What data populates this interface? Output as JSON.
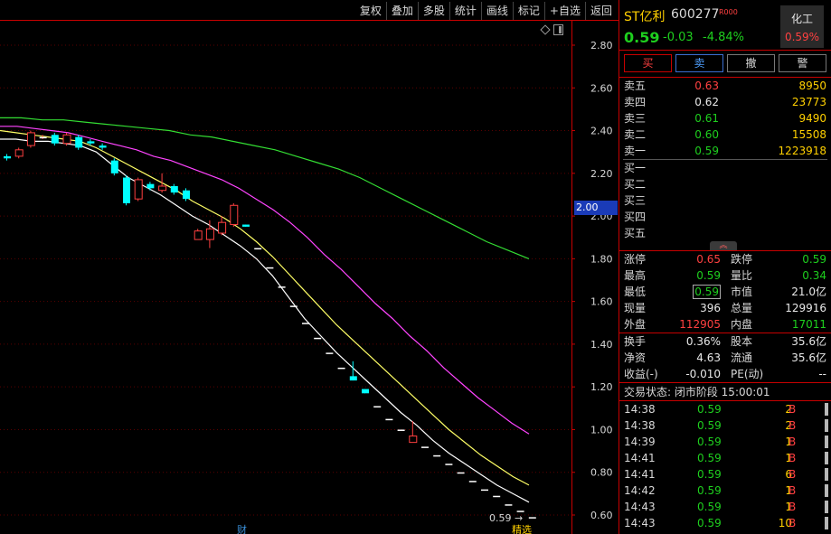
{
  "toolbar": [
    "复权",
    "叠加",
    "多股",
    "统计",
    "画线",
    "标记",
    "+自选",
    "返回"
  ],
  "chart": {
    "y_labels": [
      "2.80",
      "2.60",
      "2.40",
      "2.20",
      "2.00",
      "1.80",
      "1.60",
      "1.40",
      "1.20",
      "1.00",
      "0.80",
      "0.60"
    ],
    "current_price_tag": "2.00",
    "last_price_label": "0.59",
    "marker_cai": "财",
    "marker_jingxuan": "精选",
    "colors": {
      "up": "#ff4040",
      "down": "#00ffff",
      "ma5": "#ffffff",
      "ma10": "#ffff66",
      "ma20": "#ff44ff",
      "ma60": "#33dd33",
      "axis": "#c80000"
    }
  },
  "chart_data": {
    "type": "candlestick",
    "ylim": [
      0.58,
      2.86
    ],
    "candles": [
      {
        "o": 2.28,
        "c": 2.27,
        "h": 2.29,
        "l": 2.26
      },
      {
        "o": 2.28,
        "c": 2.31,
        "h": 2.32,
        "l": 2.27
      },
      {
        "o": 2.33,
        "c": 2.39,
        "h": 2.4,
        "l": 2.32
      },
      {
        "o": 2.37,
        "c": 2.37,
        "h": 2.38,
        "l": 2.36
      },
      {
        "o": 2.38,
        "c": 2.34,
        "h": 2.39,
        "l": 2.33
      },
      {
        "o": 2.34,
        "c": 2.38,
        "h": 2.39,
        "l": 2.33
      },
      {
        "o": 2.37,
        "c": 2.32,
        "h": 2.38,
        "l": 2.31
      },
      {
        "o": 2.35,
        "c": 2.34,
        "h": 2.36,
        "l": 2.33
      },
      {
        "o": 2.33,
        "c": 2.32,
        "h": 2.34,
        "l": 2.31
      },
      {
        "o": 2.26,
        "c": 2.2,
        "h": 2.27,
        "l": 2.19
      },
      {
        "o": 2.18,
        "c": 2.06,
        "h": 2.19,
        "l": 2.05
      },
      {
        "o": 2.08,
        "c": 2.17,
        "h": 2.18,
        "l": 2.07
      },
      {
        "o": 2.15,
        "c": 2.13,
        "h": 2.16,
        "l": 2.12
      },
      {
        "o": 2.12,
        "c": 2.14,
        "h": 2.2,
        "l": 2.11
      },
      {
        "o": 2.14,
        "c": 2.11,
        "h": 2.15,
        "l": 2.1
      },
      {
        "o": 2.12,
        "c": 2.08,
        "h": 2.13,
        "l": 2.07
      },
      {
        "o": 1.89,
        "c": 1.93,
        "h": 1.94,
        "l": 1.89
      },
      {
        "o": 1.89,
        "c": 1.94,
        "h": 1.98,
        "l": 1.85
      },
      {
        "o": 1.92,
        "c": 1.97,
        "h": 2.0,
        "l": 1.91
      },
      {
        "o": 1.96,
        "c": 2.05,
        "h": 2.06,
        "l": 1.95
      },
      {
        "o": 1.96,
        "c": 1.95,
        "h": 1.96,
        "l": 1.95
      },
      {
        "o": 1.85,
        "c": 1.85,
        "h": 1.85,
        "l": 1.85
      },
      {
        "o": 1.76,
        "c": 1.76,
        "h": 1.76,
        "l": 1.76
      },
      {
        "o": 1.67,
        "c": 1.67,
        "h": 1.67,
        "l": 1.67
      },
      {
        "o": 1.58,
        "c": 1.58,
        "h": 1.58,
        "l": 1.58
      },
      {
        "o": 1.5,
        "c": 1.5,
        "h": 1.5,
        "l": 1.5
      },
      {
        "o": 1.43,
        "c": 1.43,
        "h": 1.43,
        "l": 1.43
      },
      {
        "o": 1.36,
        "c": 1.36,
        "h": 1.36,
        "l": 1.36
      },
      {
        "o": 1.29,
        "c": 1.29,
        "h": 1.29,
        "l": 1.29
      },
      {
        "o": 1.25,
        "c": 1.23,
        "h": 1.32,
        "l": 1.23
      },
      {
        "o": 1.19,
        "c": 1.17,
        "h": 1.19,
        "l": 1.17
      },
      {
        "o": 1.11,
        "c": 1.11,
        "h": 1.11,
        "l": 1.11
      },
      {
        "o": 1.05,
        "c": 1.05,
        "h": 1.05,
        "l": 1.05
      },
      {
        "o": 1.0,
        "c": 1.0,
        "h": 1.0,
        "l": 1.0
      },
      {
        "o": 0.94,
        "c": 0.97,
        "h": 1.04,
        "l": 0.94
      },
      {
        "o": 0.92,
        "c": 0.92,
        "h": 0.92,
        "l": 0.92
      },
      {
        "o": 0.88,
        "c": 0.88,
        "h": 0.88,
        "l": 0.88
      },
      {
        "o": 0.84,
        "c": 0.84,
        "h": 0.84,
        "l": 0.84
      },
      {
        "o": 0.8,
        "c": 0.8,
        "h": 0.8,
        "l": 0.8
      },
      {
        "o": 0.76,
        "c": 0.76,
        "h": 0.76,
        "l": 0.76
      },
      {
        "o": 0.72,
        "c": 0.72,
        "h": 0.72,
        "l": 0.72
      },
      {
        "o": 0.69,
        "c": 0.69,
        "h": 0.69,
        "l": 0.69
      },
      {
        "o": 0.65,
        "c": 0.65,
        "h": 0.65,
        "l": 0.65
      },
      {
        "o": 0.62,
        "c": 0.62,
        "h": 0.62,
        "l": 0.62
      },
      {
        "o": 0.59,
        "c": 0.59,
        "h": 0.59,
        "l": 0.59
      }
    ],
    "ma_lines": [
      {
        "name": "ma5",
        "values": [
          2.36,
          2.36,
          2.35,
          2.35,
          2.34,
          2.33,
          2.3,
          2.24,
          2.18,
          2.14,
          2.1,
          2.05,
          2.0,
          1.96,
          1.91,
          1.86,
          1.8,
          1.72,
          1.62,
          1.52,
          1.44,
          1.36,
          1.29,
          1.22,
          1.15,
          1.08,
          1.02,
          0.95,
          0.89,
          0.84,
          0.79,
          0.74,
          0.7,
          0.66
        ]
      },
      {
        "name": "ma10",
        "values": [
          2.4,
          2.39,
          2.38,
          2.37,
          2.36,
          2.35,
          2.32,
          2.28,
          2.24,
          2.2,
          2.16,
          2.12,
          2.07,
          2.03,
          1.99,
          1.94,
          1.88,
          1.81,
          1.73,
          1.65,
          1.57,
          1.49,
          1.42,
          1.35,
          1.28,
          1.21,
          1.14,
          1.07,
          1.0,
          0.94,
          0.88,
          0.83,
          0.78,
          0.74
        ]
      },
      {
        "name": "ma20",
        "values": [
          2.42,
          2.42,
          2.41,
          2.4,
          2.39,
          2.37,
          2.35,
          2.33,
          2.31,
          2.28,
          2.26,
          2.23,
          2.2,
          2.17,
          2.13,
          2.08,
          2.03,
          1.97,
          1.9,
          1.82,
          1.75,
          1.67,
          1.59,
          1.52,
          1.44,
          1.37,
          1.29,
          1.22,
          1.15,
          1.09,
          1.03,
          0.98
        ]
      },
      {
        "name": "ma60",
        "values": [
          2.46,
          2.46,
          2.45,
          2.45,
          2.44,
          2.43,
          2.42,
          2.41,
          2.4,
          2.38,
          2.37,
          2.35,
          2.33,
          2.31,
          2.28,
          2.25,
          2.22,
          2.18,
          2.13,
          2.08,
          2.03,
          1.98,
          1.93,
          1.88,
          1.84,
          1.8
        ]
      }
    ]
  },
  "stock": {
    "name": "ST亿利",
    "code": "600277",
    "badge": "R000",
    "price": "0.59",
    "change": "-0.03",
    "change_pct": "-4.84%",
    "sector": "化工",
    "sector_pct": "0.59%"
  },
  "actions": {
    "buy": "买",
    "sell": "卖",
    "cancel": "撤",
    "alert": "警"
  },
  "order_book": {
    "asks": [
      {
        "label": "卖五",
        "price": "0.63",
        "vol": "8950",
        "color": "red"
      },
      {
        "label": "卖四",
        "price": "0.62",
        "vol": "23773",
        "color": "white"
      },
      {
        "label": "卖三",
        "price": "0.61",
        "vol": "9490",
        "color": "green"
      },
      {
        "label": "卖二",
        "price": "0.60",
        "vol": "15508",
        "color": "green"
      },
      {
        "label": "卖一",
        "price": "0.59",
        "vol": "1223918",
        "color": "green"
      }
    ],
    "bids": [
      {
        "label": "买一",
        "price": "",
        "vol": ""
      },
      {
        "label": "买二",
        "price": "",
        "vol": ""
      },
      {
        "label": "买三",
        "price": "",
        "vol": ""
      },
      {
        "label": "买四",
        "price": "",
        "vol": ""
      },
      {
        "label": "买五",
        "price": "",
        "vol": ""
      }
    ],
    "expand_glyph": "︽"
  },
  "stats": {
    "zhangting_k": "涨停",
    "zhangting_v": "0.65",
    "dieting_k": "跌停",
    "dieting_v": "0.59",
    "zuigao_k": "最高",
    "zuigao_v": "0.59",
    "liangbi_k": "量比",
    "liangbi_v": "0.34",
    "zuidi_k": "最低",
    "zuidi_v": "0.59",
    "shizhi_k": "市值",
    "shizhi_v": "21.0亿",
    "xianliang_k": "现量",
    "xianliang_v": "396",
    "zongliang_k": "总量",
    "zongliang_v": "129916",
    "waipan_k": "外盘",
    "waipan_v": "112905",
    "neipan_k": "内盘",
    "neipan_v": "17011",
    "huanshou_k": "换手",
    "huanshou_v": "0.36%",
    "guben_k": "股本",
    "guben_v": "35.6亿",
    "jingzi_k": "净资",
    "jingzi_v": "4.63",
    "liutong_k": "流通",
    "liutong_v": "35.6亿",
    "shouyi_k": "收益(-)",
    "shouyi_v": "-0.010",
    "pe_k": "PE(动)",
    "pe_v": "--"
  },
  "trade_status": "交易状态: 闭市阶段 15:00:01",
  "ticks": [
    {
      "time": "14:38",
      "price": "0.59",
      "vol": "2",
      "side": "B"
    },
    {
      "time": "14:38",
      "price": "0.59",
      "vol": "2",
      "side": "B"
    },
    {
      "time": "14:39",
      "price": "0.59",
      "vol": "1",
      "side": "B"
    },
    {
      "time": "14:41",
      "price": "0.59",
      "vol": "1",
      "side": "B"
    },
    {
      "time": "14:41",
      "price": "0.59",
      "vol": "6",
      "side": "B"
    },
    {
      "time": "14:42",
      "price": "0.59",
      "vol": "1",
      "side": "B"
    },
    {
      "time": "14:43",
      "price": "0.59",
      "vol": "1",
      "side": "B"
    },
    {
      "time": "14:43",
      "price": "0.59",
      "vol": "10",
      "side": "B"
    }
  ]
}
